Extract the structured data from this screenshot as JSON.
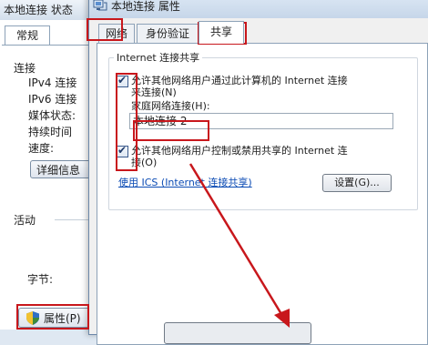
{
  "status_window": {
    "title": "本地连接 状态",
    "tab": "常规",
    "connection_heading": "连接",
    "ipv4_label": "IPv4 连接",
    "ipv6_label": "IPv6 连接",
    "media_label": "媒体状态:",
    "duration_label": "持续时间",
    "speed_label": "速度:",
    "details_button": "详细信息",
    "activity_heading": "活动",
    "bytes_label": "字节:",
    "properties_button": "属性(P)"
  },
  "properties_window": {
    "title": "本地连接 属性",
    "tabs": [
      {
        "label": "网络",
        "active": false
      },
      {
        "label": "身份验证",
        "active": false
      },
      {
        "label": "共享",
        "active": true
      }
    ],
    "group_title": "Internet 连接共享",
    "allow_connect_line1": "允许其他网络用户通过此计算机的 Internet 连接",
    "allow_connect_line2": "来连接(N)",
    "allow_connect_checked": true,
    "home_network_label": "家庭网络连接(H):",
    "home_network_value": "本地连接 2",
    "allow_control_line1": "允许其他网络用户控制或禁用共享的 Internet 连",
    "allow_control_line2": "接(O)",
    "allow_control_checked": true,
    "ics_link": "使用 ICS (Internet 连接共享)",
    "settings_button": "设置(G)..."
  },
  "colors": {
    "annotation": "#c8171c",
    "link": "#0b4bb4"
  }
}
